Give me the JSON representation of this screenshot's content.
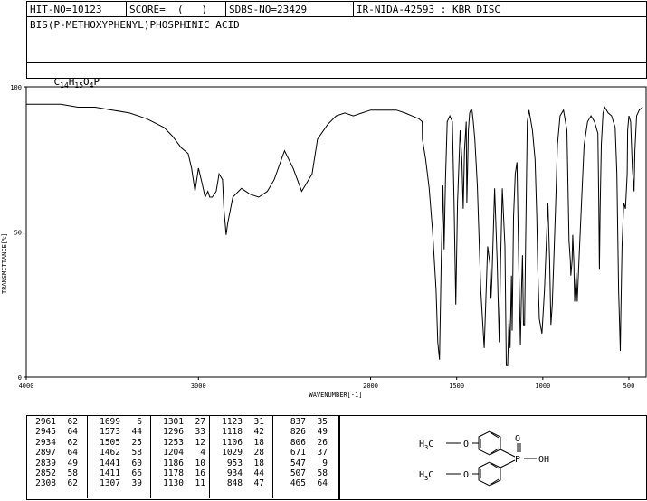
{
  "header": {
    "hit_no": "HIT-NO=10123",
    "score": "SCORE=  (   )",
    "sdbs_no": "SDBS-NO=23429",
    "ir_info": "IR-NIDA-42593 : KBR DISC",
    "compound_name": "BIS(P-METHOXYPHENYL)PHOSPHINIC ACID",
    "formula": {
      "c": "C",
      "c_n": "14",
      "h": "H",
      "h_n": "15",
      "o": "O",
      "o_n": "4",
      "p": "P"
    }
  },
  "chart_data": {
    "type": "line",
    "xlabel": "WAVENUMBER[-1]",
    "ylabel": "TRANSMITTANCE[%]",
    "xlim": [
      4000,
      400
    ],
    "ylim": [
      0,
      100
    ],
    "x_ticks": [
      4000,
      3000,
      2000,
      1500,
      1000,
      500
    ],
    "y_ticks": [
      0,
      50,
      100
    ],
    "x": [
      4000,
      3900,
      3800,
      3700,
      3600,
      3500,
      3400,
      3300,
      3200,
      3150,
      3100,
      3060,
      3040,
      3020,
      3000,
      2980,
      2961,
      2945,
      2934,
      2920,
      2897,
      2880,
      2860,
      2852,
      2839,
      2830,
      2800,
      2750,
      2700,
      2650,
      2600,
      2560,
      2500,
      2450,
      2400,
      2340,
      2308,
      2250,
      2200,
      2150,
      2100,
      2050,
      2000,
      1960,
      1900,
      1850,
      1800,
      1760,
      1720,
      1700,
      1699,
      1680,
      1660,
      1640,
      1620,
      1610,
      1600,
      1590,
      1580,
      1573,
      1565,
      1555,
      1540,
      1525,
      1515,
      1505,
      1495,
      1480,
      1470,
      1462,
      1455,
      1445,
      1441,
      1432,
      1425,
      1418,
      1411,
      1404,
      1395,
      1380,
      1360,
      1340,
      1320,
      1307,
      1301,
      1296,
      1290,
      1280,
      1265,
      1253,
      1245,
      1235,
      1220,
      1212,
      1204,
      1196,
      1190,
      1182,
      1178,
      1170,
      1160,
      1150,
      1140,
      1130,
      1123,
      1118,
      1112,
      1106,
      1100,
      1090,
      1080,
      1060,
      1045,
      1035,
      1029,
      1020,
      1005,
      990,
      970,
      960,
      953,
      945,
      934,
      925,
      915,
      900,
      880,
      860,
      848,
      840,
      837,
      830,
      826,
      820,
      815,
      806,
      800,
      790,
      775,
      760,
      740,
      720,
      700,
      690,
      680,
      675,
      671,
      667,
      660,
      650,
      640,
      630,
      620,
      600,
      590,
      580,
      570,
      560,
      550,
      547,
      540,
      530,
      520,
      510,
      507,
      500,
      490,
      480,
      470,
      465,
      455,
      440,
      420,
      400
    ],
    "series": [
      {
        "values": [
          94,
          94,
          94,
          93,
          93,
          92,
          91,
          89,
          86,
          83,
          79,
          77,
          72,
          64,
          72,
          67,
          62,
          64,
          62,
          62,
          64,
          70,
          68,
          58,
          49,
          53,
          62,
          65,
          63,
          62,
          64,
          68,
          78,
          72,
          64,
          70,
          82,
          87,
          90,
          91,
          90,
          91,
          92,
          92,
          92,
          92,
          91,
          90,
          89,
          88,
          82,
          75,
          65,
          50,
          30,
          12,
          6,
          40,
          66,
          44,
          68,
          88,
          90,
          88,
          60,
          25,
          60,
          85,
          75,
          58,
          78,
          88,
          60,
          85,
          91,
          92,
          92,
          88,
          82,
          66,
          30,
          10,
          45,
          39,
          27,
          33,
          45,
          65,
          40,
          12,
          40,
          65,
          45,
          4,
          4,
          20,
          10,
          35,
          16,
          55,
          70,
          74,
          40,
          11,
          31,
          42,
          18,
          18,
          45,
          88,
          92,
          85,
          75,
          55,
          37,
          20,
          15,
          30,
          60,
          40,
          18,
          25,
          44,
          60,
          80,
          90,
          92,
          85,
          47,
          40,
          35,
          40,
          49,
          40,
          26,
          36,
          26,
          40,
          60,
          80,
          88,
          90,
          88,
          86,
          84,
          60,
          37,
          58,
          80,
          91,
          93,
          92,
          91,
          90,
          88,
          86,
          70,
          30,
          9,
          20,
          45,
          60,
          58,
          70,
          85,
          90,
          88,
          72,
          64,
          78,
          90,
          92,
          93
        ]
      }
    ]
  },
  "peak_table": [
    [
      [
        "2961",
        "62"
      ],
      [
        "2945",
        "64"
      ],
      [
        "2934",
        "62"
      ],
      [
        "2897",
        "64"
      ],
      [
        "2839",
        "49"
      ],
      [
        "2852",
        "58"
      ],
      [
        "2308",
        "62"
      ]
    ],
    [
      [
        "1699",
        "6"
      ],
      [
        "1573",
        "44"
      ],
      [
        "1505",
        "25"
      ],
      [
        "1462",
        "58"
      ],
      [
        "1441",
        "60"
      ],
      [
        "1411",
        "66"
      ],
      [
        "1307",
        "39"
      ]
    ],
    [
      [
        "1301",
        "27"
      ],
      [
        "1296",
        "33"
      ],
      [
        "1253",
        "12"
      ],
      [
        "1204",
        "4"
      ],
      [
        "1186",
        "10"
      ],
      [
        "1178",
        "16"
      ],
      [
        "1130",
        "11"
      ]
    ],
    [
      [
        "1123",
        "31"
      ],
      [
        "1118",
        "42"
      ],
      [
        "1106",
        "18"
      ],
      [
        "1029",
        "28"
      ],
      [
        "953",
        "18"
      ],
      [
        "934",
        "44"
      ],
      [
        "848",
        "47"
      ]
    ],
    [
      [
        "837",
        "35"
      ],
      [
        "826",
        "49"
      ],
      [
        "806",
        "26"
      ],
      [
        "671",
        "37"
      ],
      [
        "547",
        "9"
      ],
      [
        "507",
        "58"
      ],
      [
        "465",
        "64"
      ]
    ]
  ],
  "structure": {
    "methyl_top": "H",
    "methyl_top_sub": "3",
    "methyl_top_c": "C",
    "methyl_bottom": "H",
    "methyl_bottom_sub": "3",
    "methyl_bottom_c": "C",
    "o1": "O",
    "o2": "O",
    "p": "P",
    "o_dbl": "O",
    "oh": "OH"
  }
}
